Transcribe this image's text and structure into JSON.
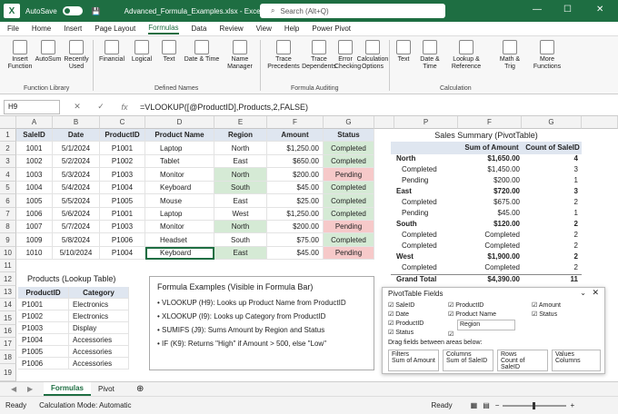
{
  "titlebar": {
    "autosave_label": "AutoSave",
    "autosave_state": "ON",
    "file_name": "Advanced_Formula_Examples.xlsx - Excel",
    "search_placeholder": "Search (Alt+Q)"
  },
  "menu": [
    "File",
    "Home",
    "Insert",
    "Page Layout",
    "Formulas",
    "Data",
    "Review",
    "View",
    "Help",
    "Power Pivot"
  ],
  "ribbon": {
    "buttons": [
      "Insert Function",
      "AutoSum",
      "Recently Used",
      "Financial",
      "Logical",
      "Text",
      "Date & Time",
      "Name Manager",
      "Trace Precedents",
      "Trace Dependents",
      "Error Checking",
      "Calculation Options",
      "Text",
      "Date & Time",
      "Lookup & Reference",
      "Math & Trig",
      "More Functions"
    ],
    "groups": [
      "Function Library",
      "Defined Names",
      "Formula Auditing",
      "Calculation"
    ]
  },
  "formula_bar": {
    "name_box": "H9",
    "cancel": "✕",
    "enter": "✓",
    "fx": "fx",
    "formula": "=VLOOKUP([@ProductID],Products,2,FALSE)"
  },
  "columns": [
    "A",
    "B",
    "C",
    "D",
    "E",
    "F",
    "G"
  ],
  "sales_table": {
    "headers": [
      "SaleID",
      "Date",
      "ProductID",
      "Product Name",
      "Region",
      "Amount",
      "Status"
    ],
    "rows": [
      [
        "1001",
        "5/1/2024",
        "P1001",
        "Laptop",
        "North",
        "$1,250.00",
        "Completed"
      ],
      [
        "1002",
        "5/2/2024",
        "P1002",
        "Tablet",
        "East",
        "$650.00",
        "Completed"
      ],
      [
        "1003",
        "5/3/2024",
        "P1003",
        "Monitor",
        "North",
        "$200.00",
        "Pending"
      ],
      [
        "1004",
        "5/4/2024",
        "P1004",
        "Keyboard",
        "South",
        "$45.00",
        "Completed"
      ],
      [
        "1005",
        "5/5/2024",
        "P1005",
        "Mouse",
        "East",
        "$25.00",
        "Completed"
      ],
      [
        "1006",
        "5/6/2024",
        "P1001",
        "Laptop",
        "West",
        "$1,250.00",
        "Completed"
      ],
      [
        "1007",
        "5/7/2024",
        "P1003",
        "Monitor",
        "North",
        "$200.00",
        "Pending"
      ],
      [
        "1009",
        "5/8/2024",
        "P1006",
        "Headset",
        "South",
        "$75.00",
        "Completed"
      ],
      [
        "1010",
        "5/10/2024",
        "P1004",
        "Keyboard",
        "East",
        "$45.00",
        "Pending"
      ]
    ],
    "row_numbers": [
      "1",
      "2",
      "3",
      "4",
      "5",
      "6",
      "7",
      "8",
      "9",
      "10",
      "11",
      "12",
      "13",
      "14",
      "15",
      "16",
      "17",
      "18",
      "19"
    ]
  },
  "pivot_cols": [
    "P",
    "F",
    "G"
  ],
  "pivot": {
    "title": "Sales Summary (PivotTable)",
    "headers": [
      "",
      "Sum of Amount",
      "Count of SaleID"
    ],
    "rows": [
      [
        "North",
        "$1,650.00",
        "4"
      ],
      [
        "Completed",
        "$1,450.00",
        "3"
      ],
      [
        "Pending",
        "$200.00",
        "1"
      ],
      [
        "East",
        "$720.00",
        "3"
      ],
      [
        "Completed",
        "$675.00",
        "2"
      ],
      [
        "Pending",
        "$45.00",
        "1"
      ],
      [
        "South",
        "$120.00",
        "2"
      ],
      [
        "Completed",
        "Completed",
        "2"
      ],
      [
        "Completed",
        "Completed",
        "2"
      ],
      [
        "West",
        "$1,900.00",
        "2"
      ],
      [
        "Completed",
        "Completed",
        "2"
      ],
      [
        "Grand Total",
        "$4,390.00",
        "11"
      ]
    ]
  },
  "products": {
    "title": "Products (Lookup Table)",
    "headers": [
      "ProductID",
      "Category"
    ],
    "rows": [
      [
        "P1001",
        "Electronics"
      ],
      [
        "P1002",
        "Electronics"
      ],
      [
        "P1003",
        "Display"
      ],
      [
        "P1004",
        "Accessories"
      ],
      [
        "P1005",
        "Accessories"
      ],
      [
        "P1006",
        "Accessories"
      ]
    ]
  },
  "examples": {
    "title": "Formula Examples (Visible in Formula Bar)",
    "items": [
      "VLOOKUP (H9): Looks up Product Name from ProductID",
      "XLOOKUP (I9): Looks up Category from ProductID",
      "SUMIFS (J9): Sums Amount by Region and Status",
      "IF (K9): Returns \"High\" if Amount > 500, else \"Low\""
    ]
  },
  "pivot_fields": {
    "title": "PivotTable Fields",
    "fields_col1": [
      "SaleID",
      "Date",
      "ProductID",
      "Status"
    ],
    "fields_col2": [
      "ProductID",
      "Product Name",
      "Region"
    ],
    "fields_col3": [
      "Amount",
      "Status"
    ],
    "drag_label": "Drag fields between areas below:",
    "areas": [
      {
        "name": "Filters",
        "value": "Sum of Amount"
      },
      {
        "name": "Columns",
        "value": "Sum of SaleID"
      },
      {
        "name": "Rows",
        "value": "Count of SaleID"
      },
      {
        "name": "Values",
        "value": "Columns"
      }
    ]
  },
  "sheets": [
    "Formulas",
    "Pivot"
  ],
  "status": {
    "ready": "Ready",
    "calc_mode": "Calculation Mode: Automatic",
    "ready2": "Ready",
    "zoom": "100%"
  },
  "colors": {
    "excel_green": "#1e6e42",
    "completed": "#d5ead5",
    "pending": "#f6c9c9"
  }
}
